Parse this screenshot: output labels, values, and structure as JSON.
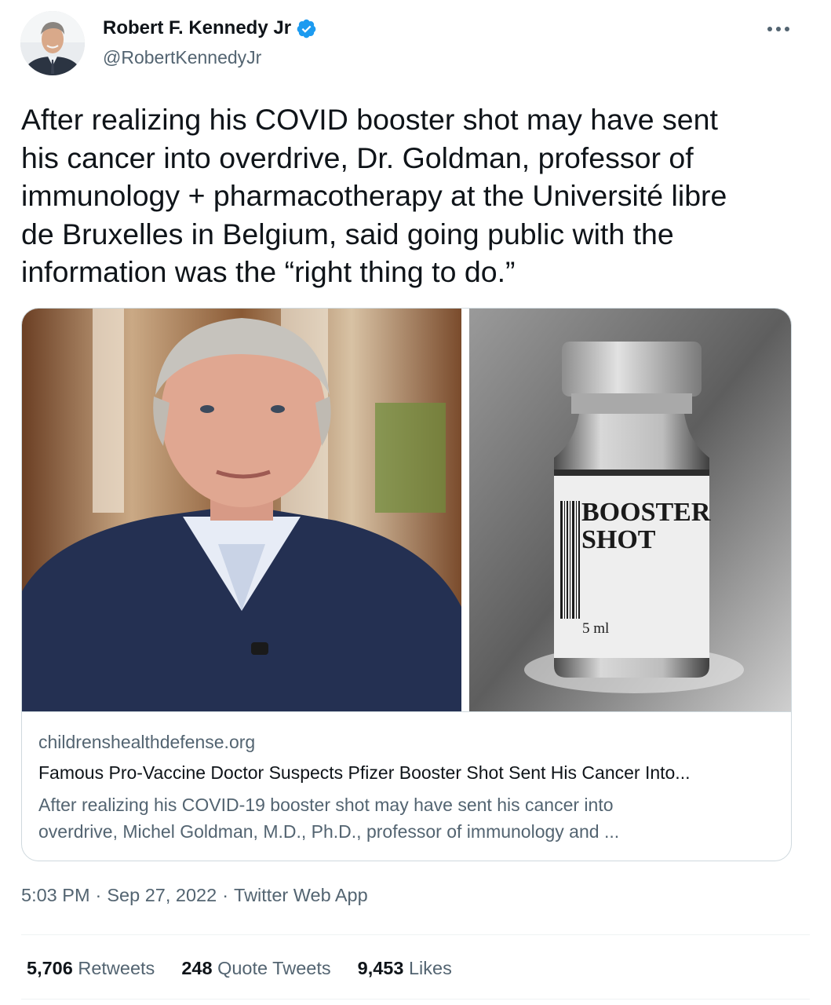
{
  "author": {
    "display_name": "Robert F. Kennedy Jr",
    "handle": "@RobertKennedyJr",
    "verified": true,
    "avatar_icon": "profile-photo"
  },
  "more_icon": "ellipsis-icon",
  "tweet": {
    "text": "After realizing his COVID booster shot may have sent\nhis cancer into overdrive, Dr. Goldman, professor of\nimmunology + pharmacotherapy at the Université libre\nde Bruxelles in Belgium, said going public with the\ninformation was the “right thing to do.”"
  },
  "card": {
    "vial_label_line1": "BOOSTER",
    "vial_label_line2": "SHOT",
    "vial_volume": "5 ml",
    "domain": "childrenshealthdefense.org",
    "title": "Famous Pro-Vaccine Doctor Suspects Pfizer Booster Shot Sent His Cancer Into...",
    "description": "After realizing his COVID-19 booster shot may have sent his cancer into\noverdrive, Michel Goldman, M.D., Ph.D., professor of immunology and ..."
  },
  "meta": {
    "time": "5:03 PM",
    "sep1": "·",
    "date": "Sep 27, 2022",
    "sep2": "·",
    "source": "Twitter Web App"
  },
  "stats": {
    "retweets_count": "5,706",
    "retweets_label": "Retweets",
    "quotes_count": "248",
    "quotes_label": "Quote Tweets",
    "likes_count": "9,453",
    "likes_label": "Likes"
  },
  "colors": {
    "text_primary": "#0f1419",
    "text_secondary": "#536471",
    "verified_blue": "#1d9bf0",
    "border": "#cfd9de"
  }
}
